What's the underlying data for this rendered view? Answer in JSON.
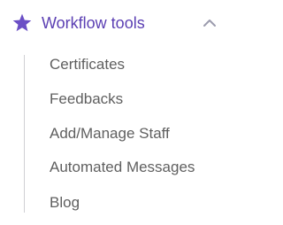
{
  "nav_group": {
    "icon": "star-icon",
    "title": "Workflow tools",
    "expanded": true,
    "toggle_icon": "chevron-up-icon",
    "accent_color": "#6b4fc6",
    "items": [
      {
        "label": "Certificates"
      },
      {
        "label": "Feedbacks"
      },
      {
        "label": "Add/Manage Staff"
      },
      {
        "label": "Automated Messages"
      },
      {
        "label": "Blog"
      }
    ]
  }
}
